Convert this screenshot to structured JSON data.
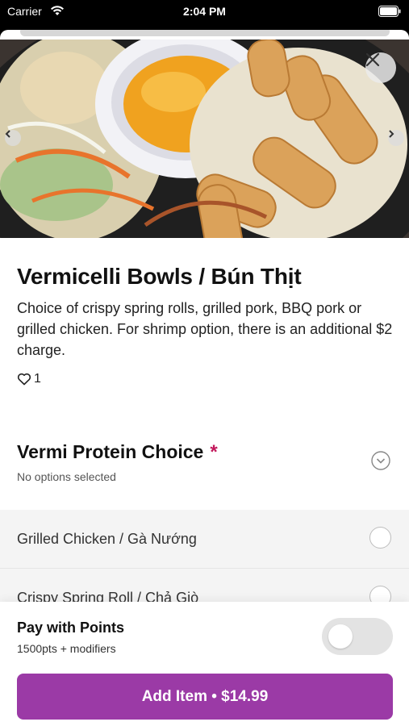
{
  "status_bar": {
    "carrier": "Carrier",
    "time": "2:04 PM"
  },
  "hero": {
    "image": "vermicelli-bowl-photo"
  },
  "item": {
    "title": "Vermicelli Bowls / Bún Thịt",
    "description": "Choice of crispy spring rolls, grilled pork, BBQ pork or grilled chicken. For shrimp option, there is an additional $2 charge.",
    "likes": "1"
  },
  "option_group": {
    "title": "Vermi Protein Choice",
    "required_mark": "*",
    "subtitle": "No options selected",
    "options": [
      {
        "label": "Grilled Chicken / Gà Nướng"
      },
      {
        "label": "Crispy Spring Roll / Chả Giò"
      }
    ]
  },
  "footer": {
    "points_title": "Pay with Points",
    "points_subtitle": "1500pts + modifiers",
    "add_button": "Add Item • $14.99"
  },
  "colors": {
    "accent": "#9b3aa6",
    "required": "#c2185b"
  }
}
